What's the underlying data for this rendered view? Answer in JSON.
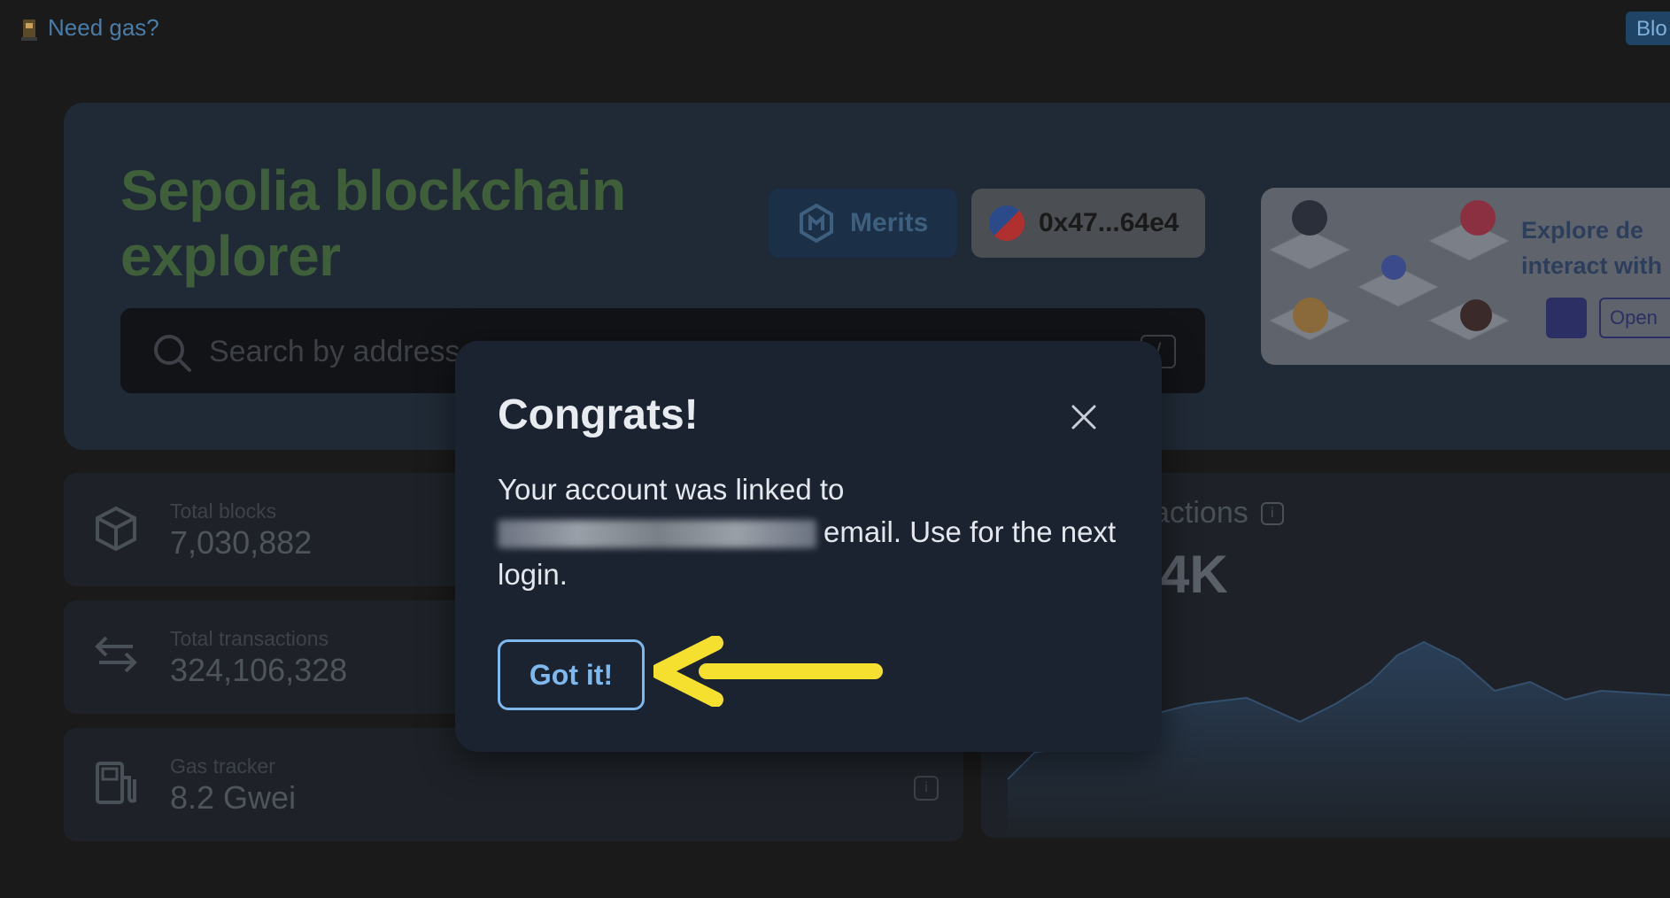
{
  "topbar": {
    "need_gas": "Need gas?",
    "right_button": "Blo"
  },
  "hero": {
    "title": "Sepolia blockchain explorer",
    "merits_label": "Merits",
    "wallet_address": "0x47...64e4",
    "search_placeholder": "Search by address",
    "search_shortcut": "/"
  },
  "promo": {
    "text": "Explore de interact with",
    "open_label": "Open"
  },
  "stats": [
    {
      "label": "Total blocks",
      "value": "7,030,882",
      "icon": "cube-icon"
    },
    {
      "label": "Total transactions",
      "value": "324,106,328",
      "icon": "arrows-exchange-icon"
    },
    {
      "label": "Gas tracker",
      "value": "8.2 Gwei",
      "icon": "gas-pump-icon"
    }
  ],
  "transactions_panel": {
    "title_fragment": "actions",
    "value_fragment": "4K"
  },
  "modal": {
    "title": "Congrats!",
    "body_before": "Your account was linked to",
    "body_after": "email. Use for the next login.",
    "confirm_label": "Got it!"
  },
  "colors": {
    "accent": "#7fb8ec",
    "modal_bg": "#1b2230",
    "arrow": "#f5e030"
  }
}
